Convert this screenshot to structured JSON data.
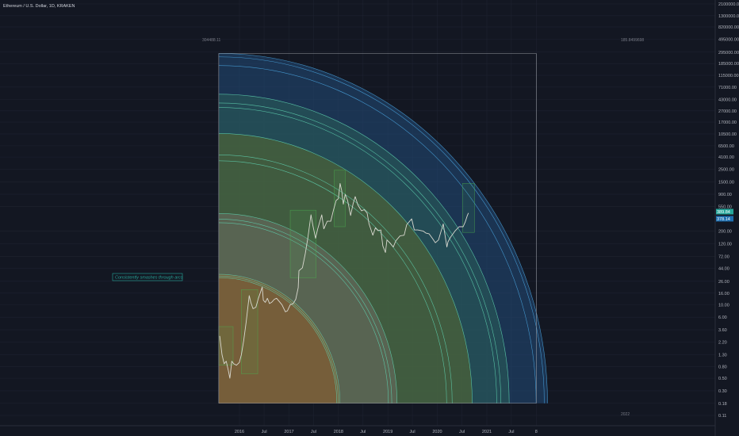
{
  "chart_data": {
    "type": "line",
    "title": "Ethereum / U.S. Dollar, 1D, KRAKEN",
    "y_scale": "log",
    "ylim": [
      0.11,
      2100000
    ],
    "xlim": [
      "2015-08-01",
      "2021-11-30"
    ],
    "y_ticks": [
      "2100000.00",
      "1300000.00",
      "820000.00",
      "495000.00",
      "295000.00",
      "185000.00",
      "115000.00",
      "71000.00",
      "43000.00",
      "27000.00",
      "17000.00",
      "10500.00",
      "6500.00",
      "4100.00",
      "2500.00",
      "1500.00",
      "900.00",
      "550.00",
      "200.00",
      "120.00",
      "72.00",
      "44.00",
      "26.00",
      "16.00",
      "10.00",
      "6.00",
      "3.60",
      "2.20",
      "1.30",
      "0.80",
      "0.50",
      "0.30",
      "0.18",
      "0.11"
    ],
    "x_ticks": [
      {
        "label": "2016",
        "date": "2016-01-01"
      },
      {
        "label": "Jul",
        "date": "2016-07-01"
      },
      {
        "label": "2017",
        "date": "2017-01-01"
      },
      {
        "label": "Jul",
        "date": "2017-07-01"
      },
      {
        "label": "2018",
        "date": "2018-01-01"
      },
      {
        "label": "Jul",
        "date": "2018-07-01"
      },
      {
        "label": "2019",
        "date": "2019-01-01"
      },
      {
        "label": "Jul",
        "date": "2019-07-01"
      },
      {
        "label": "2020",
        "date": "2020-01-01"
      },
      {
        "label": "Jul",
        "date": "2020-07-01"
      },
      {
        "label": "2021",
        "date": "2021-01-01"
      },
      {
        "label": "Jul",
        "date": "2021-07-01"
      },
      {
        "label": "8",
        "date": "2022-01-01"
      }
    ],
    "price_series": {
      "name": "ETH/USD",
      "points": [
        [
          "2015-08-08",
          2.8
        ],
        [
          "2015-08-25",
          1.3
        ],
        [
          "2015-09-10",
          0.9
        ],
        [
          "2015-09-25",
          1.0
        ],
        [
          "2015-10-10",
          0.7
        ],
        [
          "2015-10-22",
          0.5
        ],
        [
          "2015-11-05",
          1.0
        ],
        [
          "2015-11-20",
          0.9
        ],
        [
          "2015-12-10",
          0.85
        ],
        [
          "2015-12-31",
          0.95
        ],
        [
          "2016-01-15",
          1.3
        ],
        [
          "2016-02-01",
          2.3
        ],
        [
          "2016-02-20",
          5.0
        ],
        [
          "2016-03-13",
          14.5
        ],
        [
          "2016-03-25",
          11.0
        ],
        [
          "2016-04-10",
          8.5
        ],
        [
          "2016-05-01",
          9.0
        ],
        [
          "2016-05-20",
          13.0
        ],
        [
          "2016-06-17",
          20.5
        ],
        [
          "2016-06-25",
          12.0
        ],
        [
          "2016-07-10",
          11.0
        ],
        [
          "2016-07-25",
          13.0
        ],
        [
          "2016-08-10",
          10.5
        ],
        [
          "2016-08-25",
          11.0
        ],
        [
          "2016-09-15",
          12.5
        ],
        [
          "2016-10-01",
          13.0
        ],
        [
          "2016-10-20",
          11.5
        ],
        [
          "2016-11-10",
          10.0
        ],
        [
          "2016-12-05",
          7.5
        ],
        [
          "2016-12-20",
          7.8
        ],
        [
          "2017-01-10",
          10.0
        ],
        [
          "2017-02-01",
          10.5
        ],
        [
          "2017-02-20",
          12.5
        ],
        [
          "2017-03-10",
          20.0
        ],
        [
          "2017-03-15",
          40.0
        ],
        [
          "2017-04-10",
          45.0
        ],
        [
          "2017-05-01",
          80.0
        ],
        [
          "2017-05-20",
          150.0
        ],
        [
          "2017-06-12",
          390.0
        ],
        [
          "2017-06-25",
          260.0
        ],
        [
          "2017-07-16",
          150.0
        ],
        [
          "2017-08-01",
          220.0
        ],
        [
          "2017-08-31",
          390.0
        ],
        [
          "2017-09-15",
          220.0
        ],
        [
          "2017-10-10",
          300.0
        ],
        [
          "2017-11-05",
          300.0
        ],
        [
          "2017-11-25",
          470.0
        ],
        [
          "2017-12-15",
          700.0
        ],
        [
          "2017-12-31",
          750.0
        ],
        [
          "2018-01-13",
          1400.0
        ],
        [
          "2018-01-25",
          1050.0
        ],
        [
          "2018-02-06",
          600.0
        ],
        [
          "2018-02-20",
          900.0
        ],
        [
          "2018-03-10",
          700.0
        ],
        [
          "2018-04-01",
          380.0
        ],
        [
          "2018-04-20",
          620.0
        ],
        [
          "2018-05-05",
          820.0
        ],
        [
          "2018-05-25",
          580.0
        ],
        [
          "2018-06-20",
          460.0
        ],
        [
          "2018-07-10",
          480.0
        ],
        [
          "2018-08-01",
          420.0
        ],
        [
          "2018-08-15",
          270.0
        ],
        [
          "2018-09-12",
          170.0
        ],
        [
          "2018-10-01",
          230.0
        ],
        [
          "2018-10-20",
          205.0
        ],
        [
          "2018-11-10",
          210.0
        ],
        [
          "2018-11-25",
          110.0
        ],
        [
          "2018-12-14",
          84.0
        ],
        [
          "2018-12-25",
          140.0
        ],
        [
          "2019-01-15",
          125.0
        ],
        [
          "2019-02-10",
          105.0
        ],
        [
          "2019-03-01",
          135.0
        ],
        [
          "2019-04-01",
          165.0
        ],
        [
          "2019-05-01",
          170.0
        ],
        [
          "2019-05-20",
          260.0
        ],
        [
          "2019-06-26",
          330.0
        ],
        [
          "2019-07-15",
          210.0
        ],
        [
          "2019-08-10",
          210.0
        ],
        [
          "2019-09-20",
          200.0
        ],
        [
          "2019-10-10",
          185.0
        ],
        [
          "2019-11-01",
          180.0
        ],
        [
          "2019-11-25",
          150.0
        ],
        [
          "2019-12-18",
          125.0
        ],
        [
          "2020-01-10",
          140.0
        ],
        [
          "2020-02-14",
          270.0
        ],
        [
          "2020-03-12",
          105.0
        ],
        [
          "2020-03-20",
          130.0
        ],
        [
          "2020-04-10",
          160.0
        ],
        [
          "2020-05-10",
          200.0
        ],
        [
          "2020-06-10",
          240.0
        ],
        [
          "2020-07-10",
          240.0
        ],
        [
          "2020-07-25",
          290.0
        ],
        [
          "2020-08-10",
          380.0
        ],
        [
          "2020-08-18",
          420.0
        ]
      ]
    },
    "arcs": {
      "center": {
        "date": "2015-08-01",
        "price": 0.18
      },
      "bands": [
        {
          "inner_date": "2017-12-20",
          "outer_date": "2018-01-12",
          "fill": "#8f5a26",
          "edge_date": "2017-12-31"
        },
        {
          "inner_date": "2019-01-05",
          "outer_date": "2019-03-10",
          "fill": "#6b6b62",
          "edge_date": "2019-01-30"
        },
        {
          "inner_date": "2020-03-10",
          "outer_date": "2020-09-15",
          "fill": "#5a6a2e",
          "edge_date": "2020-04-20"
        },
        {
          "inner_date": "2021-03-15",
          "outer_date": "2021-06-15",
          "fill": "#2a5e58",
          "edge_date": "2021-04-15"
        },
        {
          "inner_date": "2021-12-31",
          "outer_date": "2022-03-25",
          "fill": "#234d7a",
          "edge_date": "2022-03-01"
        }
      ],
      "line_color": "#5fd3b2",
      "outer_line_color": "#4aa6e0"
    },
    "boxes": [
      {
        "start": "2015-08-01",
        "end": "2015-11-15",
        "low": 0.85,
        "high": 4.1
      },
      {
        "start": "2016-01-15",
        "end": "2016-05-15",
        "low": 0.6,
        "high": 18.5
      },
      {
        "start": "2017-01-10",
        "end": "2017-07-20",
        "low": 30.0,
        "high": 470.0
      },
      {
        "start": "2017-12-01",
        "end": "2018-02-20",
        "low": 240.0,
        "high": 2400.0
      },
      {
        "start": "2020-07-05",
        "end": "2020-10-01",
        "low": 190.0,
        "high": 1400.0
      }
    ],
    "top_left_label": "304488.11",
    "top_right_label": "185.8499698",
    "top_line_price": 280000,
    "top_line_end_date": "2022-01-01",
    "bottom_right_label": "2022",
    "price_badges": [
      "389.84",
      "378.14"
    ],
    "annotation": "Consistently smashes through arcs"
  }
}
